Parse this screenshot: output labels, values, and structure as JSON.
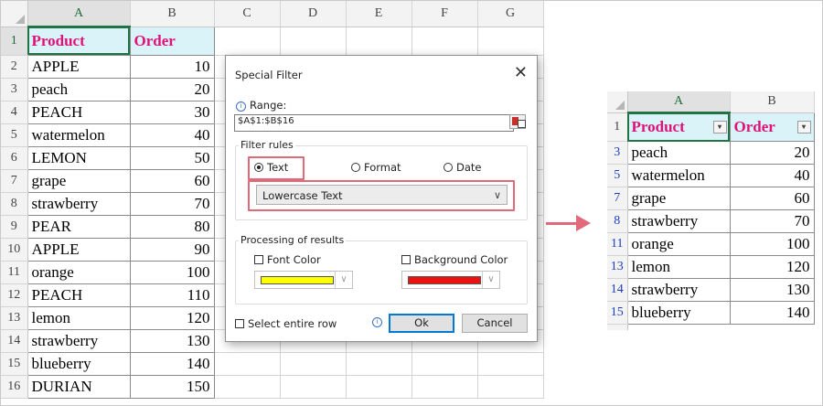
{
  "left_sheet": {
    "columns": [
      "A",
      "B",
      "C",
      "D",
      "E",
      "F",
      "G"
    ],
    "header": {
      "row": "1",
      "product": "Product",
      "order": "Order"
    },
    "rows": [
      {
        "row": "2",
        "product": "APPLE",
        "order": "10"
      },
      {
        "row": "3",
        "product": "peach",
        "order": "20"
      },
      {
        "row": "4",
        "product": "PEACH",
        "order": "30"
      },
      {
        "row": "5",
        "product": "watermelon",
        "order": "40"
      },
      {
        "row": "6",
        "product": "LEMON",
        "order": "50"
      },
      {
        "row": "7",
        "product": "grape",
        "order": "60"
      },
      {
        "row": "8",
        "product": "strawberry",
        "order": "70"
      },
      {
        "row": "9",
        "product": "PEAR",
        "order": "80"
      },
      {
        "row": "10",
        "product": "APPLE",
        "order": "90"
      },
      {
        "row": "11",
        "product": "orange",
        "order": "100"
      },
      {
        "row": "12",
        "product": "PEACH",
        "order": "110"
      },
      {
        "row": "13",
        "product": "lemon",
        "order": "120"
      },
      {
        "row": "14",
        "product": "strawberry",
        "order": "130"
      },
      {
        "row": "15",
        "product": "blueberry",
        "order": "140"
      },
      {
        "row": "16",
        "product": "DURIAN",
        "order": "150"
      }
    ]
  },
  "dialog": {
    "title": "Special Filter",
    "close_glyph": "✕",
    "info_glyph": "i",
    "range_label": "Range:",
    "range_value": "$A$1:$B$16",
    "filter_rules_label": "Filter rules",
    "option_text": "Text",
    "option_format": "Format",
    "option_date": "Date",
    "selected_option": "Text",
    "combo_value": "Lowercase Text",
    "processing_label": "Processing of results",
    "font_color_label": "Font Color",
    "background_color_label": "Background Color",
    "font_color": "#ffff00",
    "background_color": "#ee1111",
    "select_entire_row_label": "Select entire row",
    "ok_label": "Ok",
    "cancel_label": "Cancel"
  },
  "right_sheet": {
    "columns": [
      "A",
      "B"
    ],
    "header": {
      "row": "1",
      "product": "Product",
      "order": "Order"
    },
    "rows": [
      {
        "row": "3",
        "product": "peach",
        "order": "20"
      },
      {
        "row": "5",
        "product": "watermelon",
        "order": "40"
      },
      {
        "row": "7",
        "product": "grape",
        "order": "60"
      },
      {
        "row": "8",
        "product": "strawberry",
        "order": "70"
      },
      {
        "row": "11",
        "product": "orange",
        "order": "100"
      },
      {
        "row": "13",
        "product": "lemon",
        "order": "120"
      },
      {
        "row": "14",
        "product": "strawberry",
        "order": "130"
      },
      {
        "row": "15",
        "product": "blueberry",
        "order": "140"
      }
    ]
  },
  "colors": {
    "header_text": "#e0127a",
    "header_fill": "#d9f3f8",
    "arrow": "#e06a7a",
    "highlight_box": "#e06a7a"
  }
}
